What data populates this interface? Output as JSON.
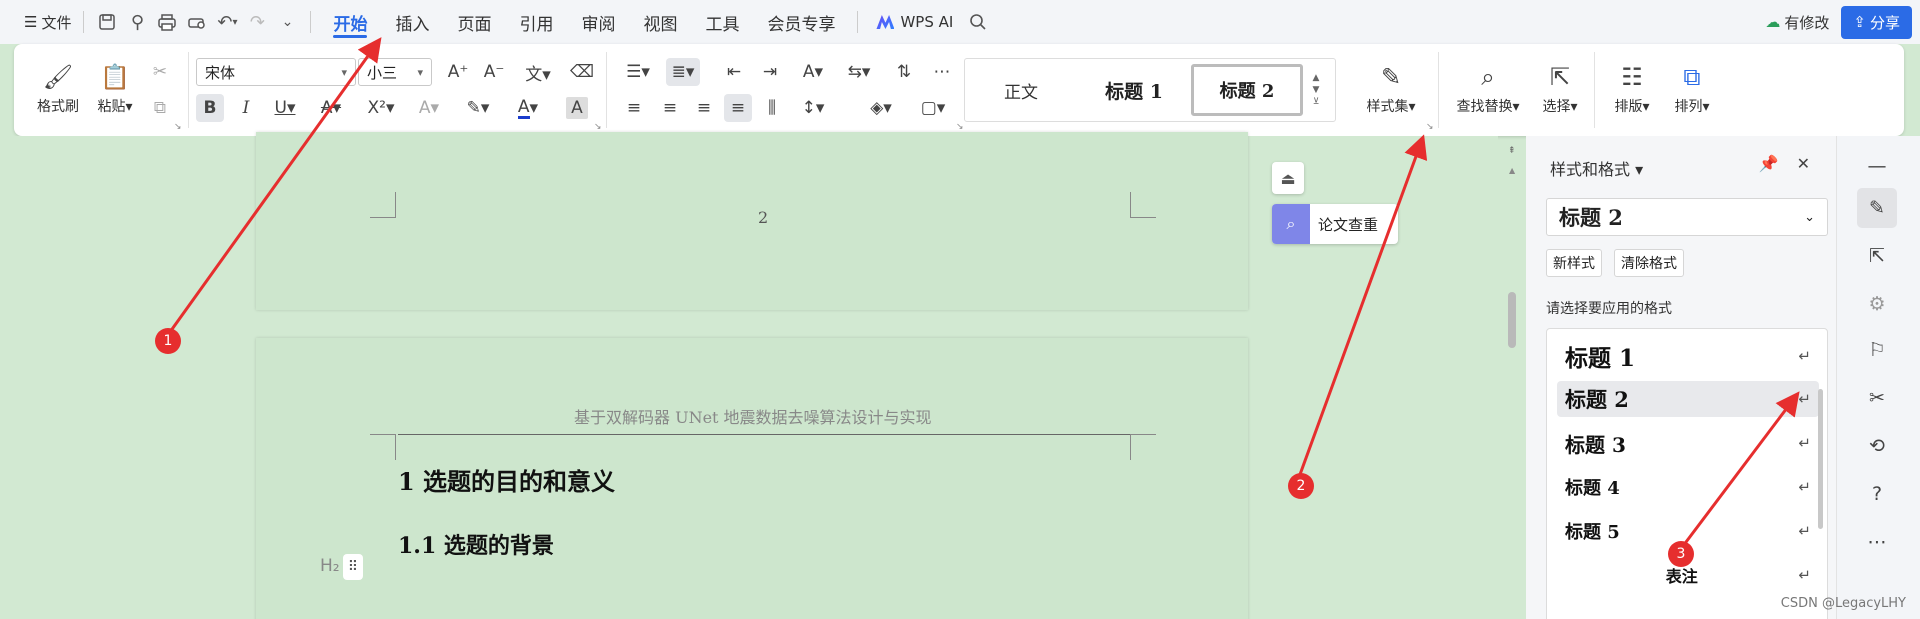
{
  "menubar": {
    "file_label": "文件",
    "tabs": [
      "开始",
      "插入",
      "页面",
      "引用",
      "审阅",
      "视图",
      "工具",
      "会员专享"
    ],
    "active_tab": "开始",
    "wps_ai_label": "WPS AI",
    "modified_label": "有修改",
    "share_label": "分享"
  },
  "ribbon": {
    "format_painter_label": "格式刷",
    "paste_label": "粘贴",
    "font_name": "宋体",
    "font_size": "小三",
    "styles": [
      "正文",
      "标题 1",
      "标题 2"
    ],
    "selected_style": "标题 2",
    "style_set_label": "样式集",
    "find_replace_label": "查找替换",
    "select_label": "选择",
    "layout_label": "排版",
    "arrange_label": "排列"
  },
  "document": {
    "page_number": "2",
    "header_text": "基于双解码器 UNet 地震数据去噪算法设计与实现",
    "heading1": "1  选题的目的和意义",
    "heading2": "1.1  选题的背景",
    "h2_marker": "H₂",
    "lunwen_label": "论文查重"
  },
  "style_pane": {
    "title": "样式和格式",
    "current_style": "标题  2",
    "new_style_label": "新样式",
    "clear_format_label": "清除格式",
    "apply_label": "请选择要应用的格式",
    "entries": [
      "标题  1",
      "标题  2",
      "标题  3",
      "标题  4",
      "标题  5",
      "表注"
    ],
    "selected_entry": "标题  2"
  },
  "annotations": {
    "markers": [
      "1",
      "2",
      "3"
    ],
    "color": "#e62e2e"
  },
  "watermark": "CSDN @LegacyLHY",
  "colors": {
    "accent": "#2b6be6",
    "doc_background": "#d2e9d2",
    "annotation_red": "#e62e2e"
  }
}
